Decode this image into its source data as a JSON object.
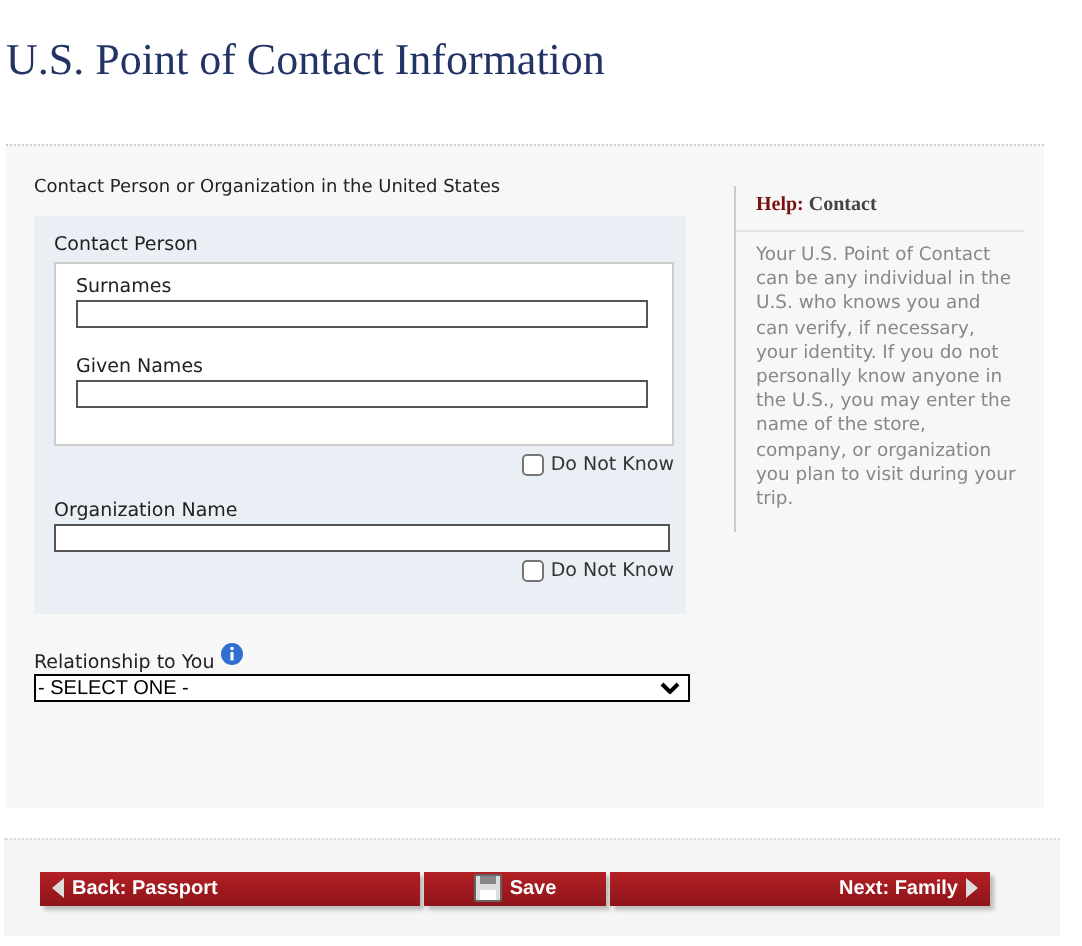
{
  "page_title": "U.S. Point of Contact Information",
  "section_title": "Contact Person or Organization in the United States",
  "contact_person": {
    "legend": "Contact Person",
    "fields": [
      {
        "label": "Surnames"
      },
      {
        "label": "Given Names"
      }
    ],
    "do_not_know": {
      "label": "Do Not Know",
      "checked": false
    }
  },
  "organization": {
    "label": "Organization Name",
    "do_not_know": {
      "label": "Do Not Know",
      "checked": false
    }
  },
  "relationship": {
    "label": "Relationship to You",
    "value": "- SELECT ONE -"
  },
  "help": {
    "label": "Help:",
    "title": "Contact",
    "text": "Your U.S. Point of Contact can be any individual in the U.S. who knows you and can verify, if necessary, your identity. If you do not personally know anyone in the U.S., you may enter the name of the store, company, or organization you plan to visit during your trip."
  },
  "buttons": [
    {
      "kind": "back",
      "label": "Back: Passport"
    },
    {
      "kind": "save",
      "label": "Save"
    },
    {
      "kind": "next",
      "label": "Next: Family"
    }
  ]
}
